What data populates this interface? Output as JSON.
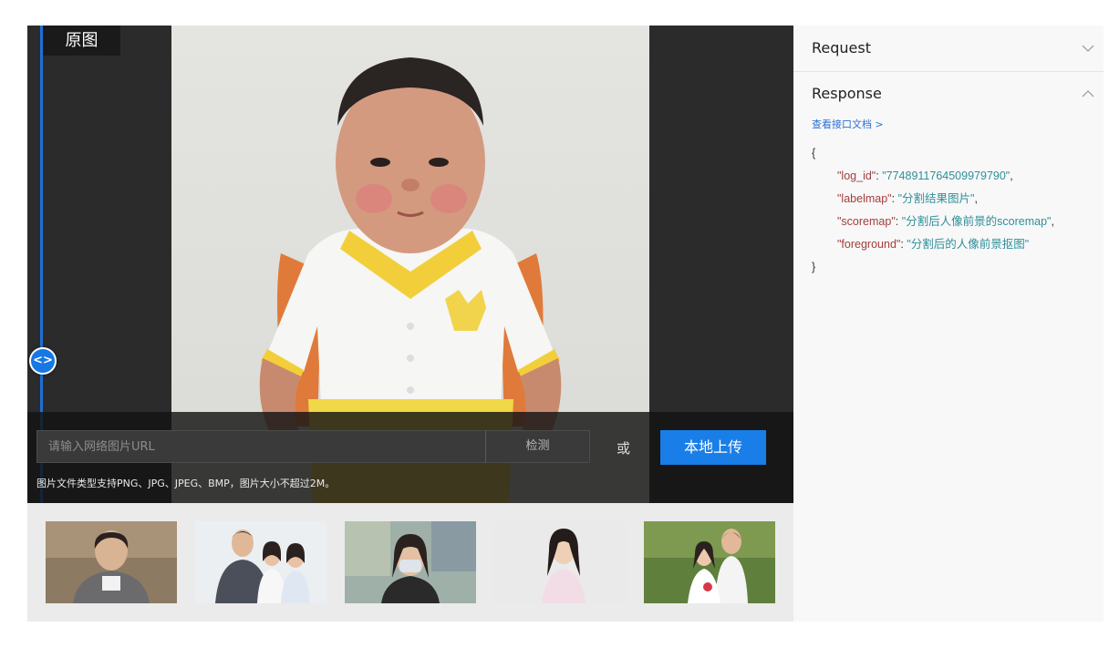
{
  "demo": {
    "badge": "原图",
    "handle_icon": "<>",
    "url_placeholder": "请输入网络图片URL",
    "detect_label": "检测",
    "or_text": "或",
    "upload_label": "本地上传",
    "hint": "图片文件类型支持PNG、JPG、JPEG、BMP，图片大小不超过2M。"
  },
  "panel": {
    "request_label": "Request",
    "response_label": "Response",
    "doc_link": "查看接口文档 >",
    "json_open": "{",
    "json_close": "}",
    "fields": [
      {
        "key": "\"log_id\"",
        "value": "\"7748911764509979790\""
      },
      {
        "key": "\"labelmap\"",
        "value": "\"分割结果图片\""
      },
      {
        "key": "\"scoremap\"",
        "value": "\"分割后人像前景的scoremap\""
      },
      {
        "key": "\"foreground\"",
        "value": "\"分割后的人像前景抠图\""
      }
    ]
  },
  "colors": {
    "accent": "#1a7ee8",
    "json_key": "#a43d3d",
    "json_value": "#2f8f9a"
  }
}
